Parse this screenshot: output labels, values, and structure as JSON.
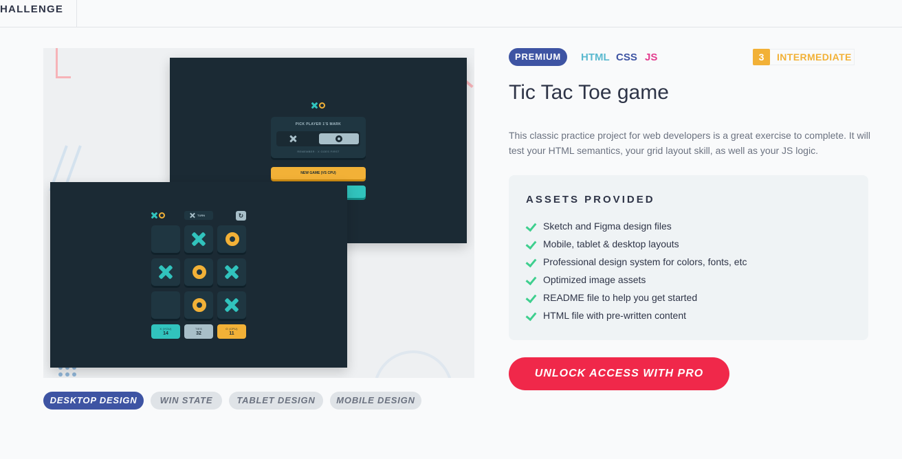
{
  "header": {
    "breadcrumb": "HALLENGE"
  },
  "preview": {
    "pick_title": "PICK PLAYER 1'S MARK",
    "pick_note": "REMEMBER : X GOES FIRST",
    "new_game_label": "NEW GAME (VS CPU)",
    "turn_label": "TURN",
    "restart_icon": "↻",
    "board": [
      "",
      "x",
      "o",
      "x",
      "o",
      "x",
      "",
      "o",
      "x"
    ],
    "scores": {
      "you_label": "X (YOU)",
      "you": "14",
      "ties_label": "TIES",
      "ties": "32",
      "cpu_label": "O (CPU)",
      "cpu": "11"
    }
  },
  "tabs": [
    {
      "label": "DESKTOP DESIGN",
      "active": true
    },
    {
      "label": "WIN STATE",
      "active": false
    },
    {
      "label": "TABLET DESIGN",
      "active": false
    },
    {
      "label": "MOBILE DESIGN",
      "active": false
    }
  ],
  "badges": {
    "premium": "PREMIUM",
    "languages": [
      {
        "label": "HTML",
        "color": "#5ab9cf"
      },
      {
        "label": "CSS",
        "color": "#3e54a3"
      },
      {
        "label": "JS",
        "color": "#e33c8e"
      }
    ],
    "difficulty_level": "3",
    "difficulty_label": "INTERMEDIATE"
  },
  "challenge": {
    "title": "Tic Tac Toe game",
    "description": "This classic practice project for web developers is a great exercise to complete. It will test your HTML semantics, your grid layout skill, as well as your JS logic."
  },
  "assets": {
    "title": "ASSETS PROVIDED",
    "items": [
      "Sketch and Figma design files",
      "Mobile, tablet & desktop layouts",
      "Professional design system for colors, fonts, etc",
      "Optimized image assets",
      "README file to help you get started",
      "HTML file with pre-written content"
    ]
  },
  "cta": {
    "label": "UNLOCK ACCESS WITH PRO"
  },
  "colors": {
    "accent_blue": "#3e54a3",
    "cta_red": "#f0284a",
    "teal": "#31c3bd",
    "yellow": "#f2b137",
    "navy": "#1b2a34",
    "check_green": "#3ecf8e"
  }
}
